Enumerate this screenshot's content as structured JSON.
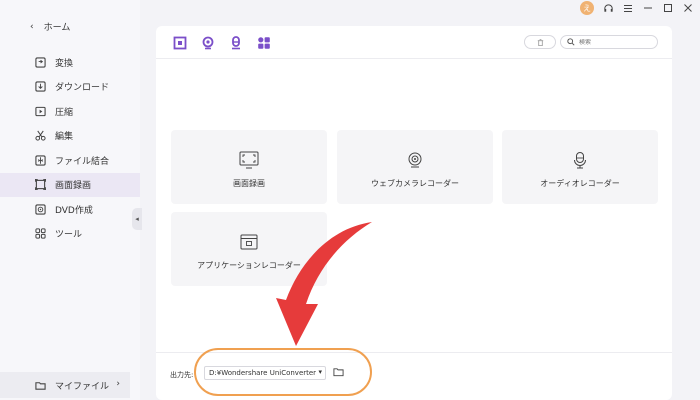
{
  "sidebar": {
    "back_label": "ホーム",
    "items": [
      {
        "label": "変換",
        "icon": "convert-icon"
      },
      {
        "label": "ダウンロード",
        "icon": "download-icon"
      },
      {
        "label": "圧縮",
        "icon": "compress-icon"
      },
      {
        "label": "編集",
        "icon": "scissors-icon"
      },
      {
        "label": "ファイル結合",
        "icon": "merge-icon"
      },
      {
        "label": "画面録画",
        "icon": "screen-record-icon",
        "active": true
      },
      {
        "label": "DVD作成",
        "icon": "dvd-icon"
      },
      {
        "label": "ツール",
        "icon": "tools-icon"
      }
    ],
    "my_files_label": "マイファイル"
  },
  "window": {
    "avatar_letter": "え",
    "accent_color": "#7b4fc9"
  },
  "search": {
    "placeholder": "検索"
  },
  "cards": [
    {
      "label": "画面録画",
      "icon": "screen-record-icon"
    },
    {
      "label": "ウェブカメラレコーダー",
      "icon": "webcam-icon"
    },
    {
      "label": "オーディオレコーダー",
      "icon": "microphone-icon"
    },
    {
      "label": "アプリケーションレコーダー",
      "icon": "app-window-icon"
    }
  ],
  "output": {
    "label": "出力先:",
    "path": "D:¥Wondershare UniConverter"
  },
  "annotation": {
    "arrow_color": "#e63b3b",
    "ring_color": "#f0a050"
  }
}
